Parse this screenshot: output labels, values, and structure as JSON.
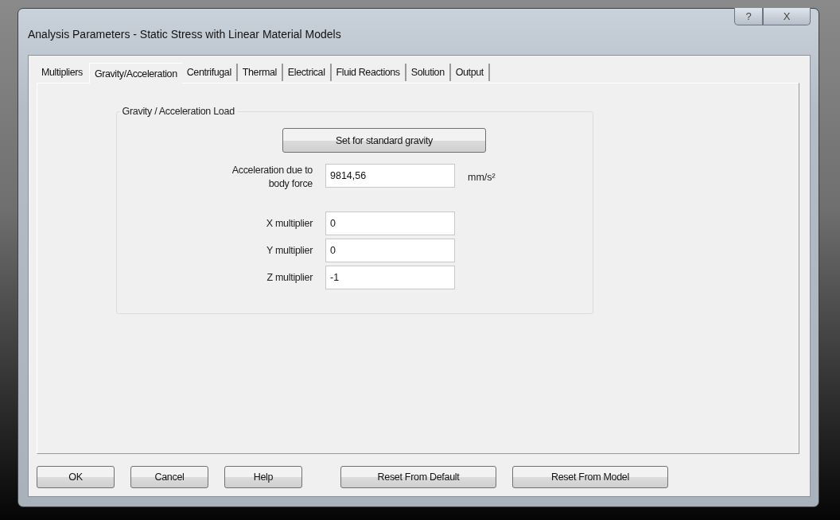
{
  "window": {
    "title": "Analysis Parameters - Static Stress with Linear Material Models",
    "controls": [
      "?",
      "X"
    ]
  },
  "tabs": [
    {
      "label": "Multipliers",
      "selected": false
    },
    {
      "label": "Gravity/Acceleration",
      "selected": true
    },
    {
      "label": "Centrifugal",
      "selected": false
    },
    {
      "label": "Thermal",
      "selected": false
    },
    {
      "label": "Electrical",
      "selected": false
    },
    {
      "label": "Fluid Reactions",
      "selected": false
    },
    {
      "label": "Solution",
      "selected": false
    },
    {
      "label": "Output",
      "selected": false
    }
  ],
  "group": {
    "title": "Gravity / Acceleration Load",
    "button": "Set for standard gravity",
    "fields": [
      {
        "kind": "main",
        "label": "Acceleration due to\nbody force",
        "value": "9814,56",
        "unit": "mm/s²"
      },
      {
        "kind": "multiplier",
        "label": "X multiplier",
        "value": "0"
      },
      {
        "kind": "multiplier",
        "label": "Y multiplier",
        "value": "0"
      },
      {
        "kind": "multiplier",
        "label": "Z multiplier",
        "value": "-1"
      }
    ]
  },
  "buttons": [
    {
      "label": "OK",
      "kind": "small"
    },
    {
      "label": "Cancel",
      "kind": "small"
    },
    {
      "label": "Help",
      "kind": "small"
    },
    {
      "label": "Reset From Default",
      "kind": "wide"
    },
    {
      "label": "Reset From Model",
      "kind": "wide"
    }
  ]
}
